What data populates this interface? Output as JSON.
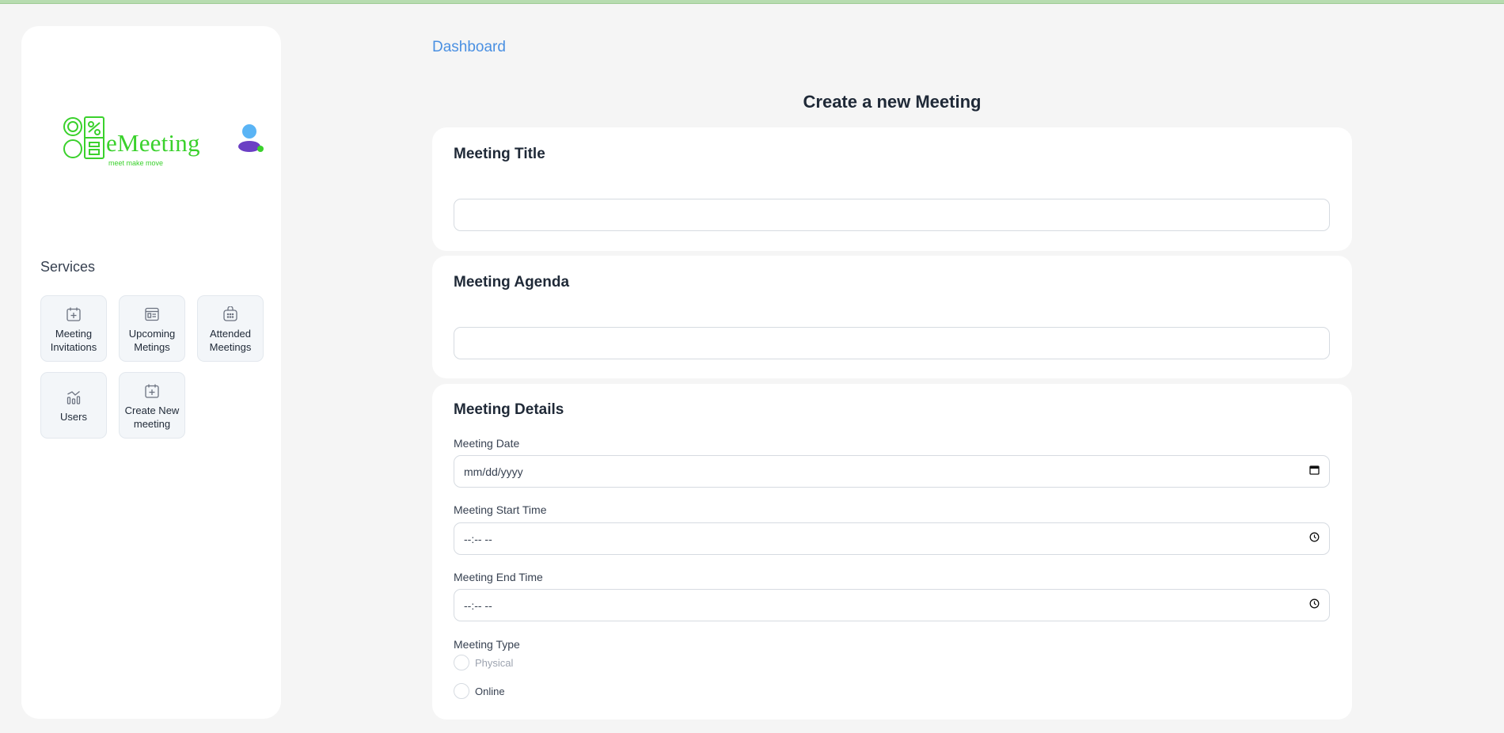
{
  "brand": {
    "name": "eMeeting",
    "tagline": "meet make move",
    "color": "#3ad12c"
  },
  "sidebar": {
    "services_title": "Services",
    "items": [
      {
        "label": "Meeting Invitations",
        "icon": "calendar-plus-icon"
      },
      {
        "label": "Upcoming Metings",
        "icon": "list-document-icon"
      },
      {
        "label": "Attended Meetings",
        "icon": "calendar-grid-icon"
      },
      {
        "label": "Users",
        "icon": "chart-trend-icon"
      },
      {
        "label": "Create New meeting",
        "icon": "calendar-plus-icon"
      }
    ]
  },
  "header": {
    "breadcrumb": "Dashboard",
    "page_title": "Create a new Meeting"
  },
  "form": {
    "title_section": {
      "heading": "Meeting Title",
      "value": ""
    },
    "agenda_section": {
      "heading": "Meeting Agenda",
      "value": ""
    },
    "details": {
      "heading": "Meeting Details",
      "date_label": "Meeting Date",
      "date_value": "mm/dd/yyyy",
      "start_label": "Meeting Start Time",
      "start_value": "--:-- --",
      "end_label": "Meeting End Time",
      "end_value": "--:-- --",
      "type_label": "Meeting Type",
      "type_options": [
        "Physical",
        "Online"
      ]
    }
  },
  "colors": {
    "link": "#4a90e2",
    "page_bg": "#f5f5f5",
    "top_strip": "#b7dcb0"
  }
}
